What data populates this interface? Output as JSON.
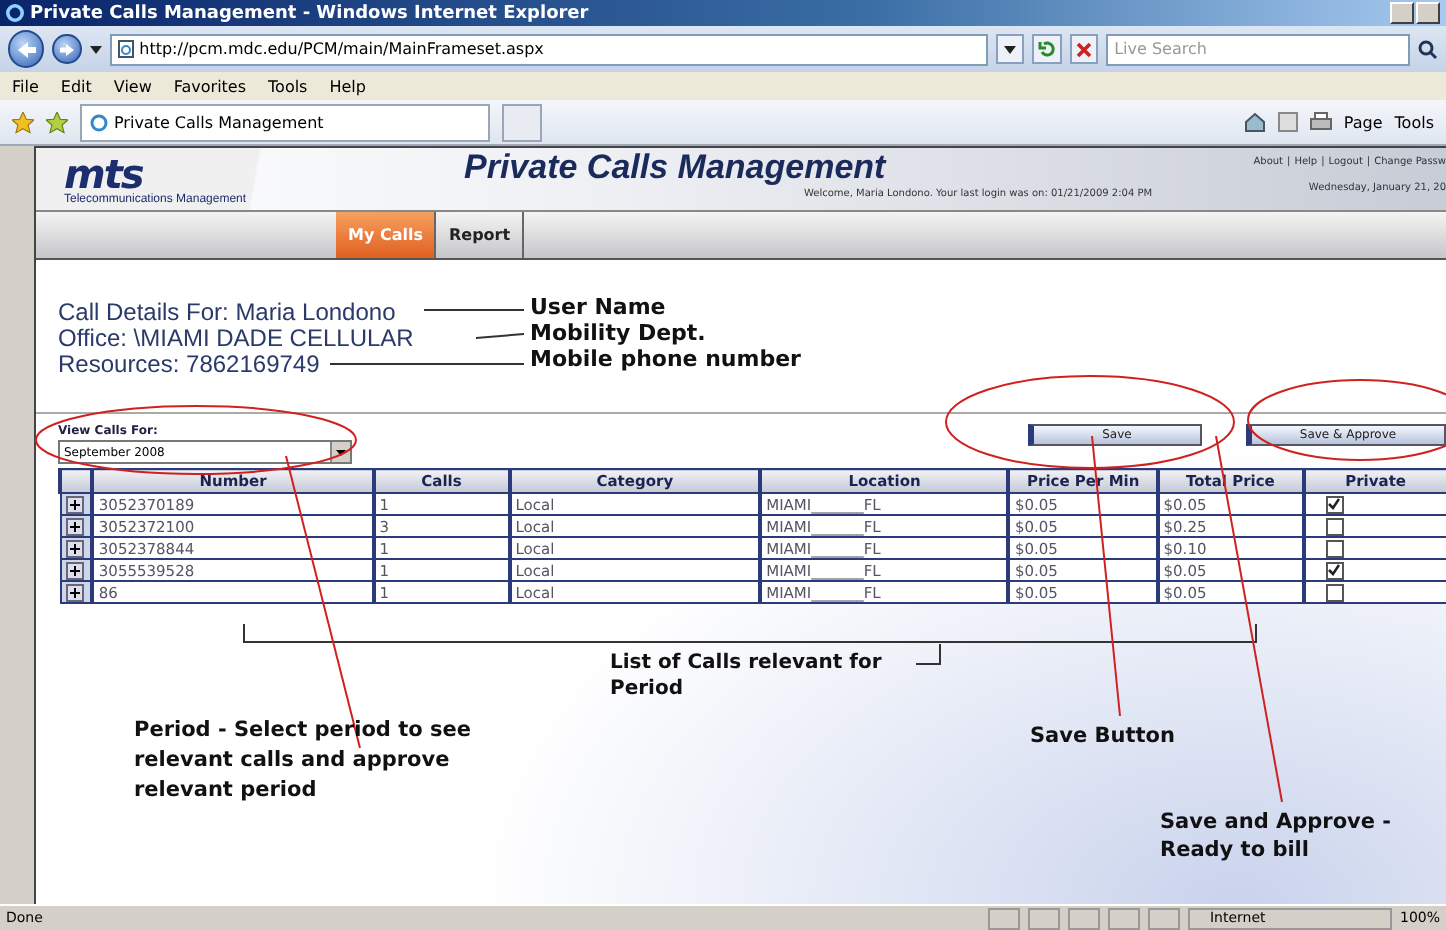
{
  "window": {
    "title": "Private Calls Management - Windows Internet Explorer"
  },
  "address_bar": {
    "url": "http://pcm.mdc.edu/PCM/main/MainFrameset.aspx",
    "search_placeholder": "Live Search"
  },
  "menu": [
    "File",
    "Edit",
    "View",
    "Favorites",
    "Tools",
    "Help"
  ],
  "favorites_bar": {
    "tab": "Private Calls Management",
    "commands": [
      "Page",
      "Tools"
    ]
  },
  "header": {
    "logo": "mts",
    "logo_tagline": "Telecommunications Management",
    "title": "Private Calls Management",
    "links": [
      "About",
      "Help",
      "Logout",
      "Change Passw"
    ],
    "separator": "|",
    "welcome": "Welcome, Maria Londono. Your last login was on: 01/21/2009 2:04 PM",
    "date": "Wednesday, January 21, 20"
  },
  "nav_tabs": [
    {
      "label": "My Calls",
      "selected": true
    },
    {
      "label": "Report",
      "selected": false
    }
  ],
  "details": [
    "Call Details For: Maria Londono",
    "Office: \\MIAMI DADE CELLULAR",
    "Resources: 7862169749"
  ],
  "period": {
    "label": "View Calls For:",
    "value": "September 2008"
  },
  "buttons": [
    "Save",
    "Save & Approve"
  ],
  "table": {
    "columns": [
      "Number",
      "Calls",
      "Category",
      "Location",
      "Price Per Min",
      "Total Price",
      "Private"
    ],
    "rows": [
      {
        "number": "3052370189",
        "calls": "1",
        "category": "Local",
        "location": "MIAMI_______FL",
        "price_per_min": "$0.05",
        "total_price": "$0.05",
        "private": true
      },
      {
        "number": "3052372100",
        "calls": "3",
        "category": "Local",
        "location": "MIAMI_______FL",
        "price_per_min": "$0.05",
        "total_price": "$0.25",
        "private": false
      },
      {
        "number": "3052378844",
        "calls": "1",
        "category": "Local",
        "location": "MIAMI_______FL",
        "price_per_min": "$0.05",
        "total_price": "$0.10",
        "private": false
      },
      {
        "number": "3055539528",
        "calls": "1",
        "category": "Local",
        "location": "MIAMI_______FL",
        "price_per_min": "$0.05",
        "total_price": "$0.05",
        "private": true
      },
      {
        "number": "86",
        "calls": "1",
        "category": "Local",
        "location": "MIAMI_______FL",
        "price_per_min": "$0.05",
        "total_price": "$0.05",
        "private": false
      }
    ]
  },
  "annotations": [
    "User Name",
    "Mobility Dept.",
    "Mobile phone number",
    "List of Calls relevant for Period",
    "Period - Select period to see relevant calls and approve relevant period",
    "Save Button",
    "Save and Approve - Ready to bill"
  ],
  "status_bar": {
    "text": "Done",
    "zone": "Internet",
    "zoom": "100%"
  }
}
